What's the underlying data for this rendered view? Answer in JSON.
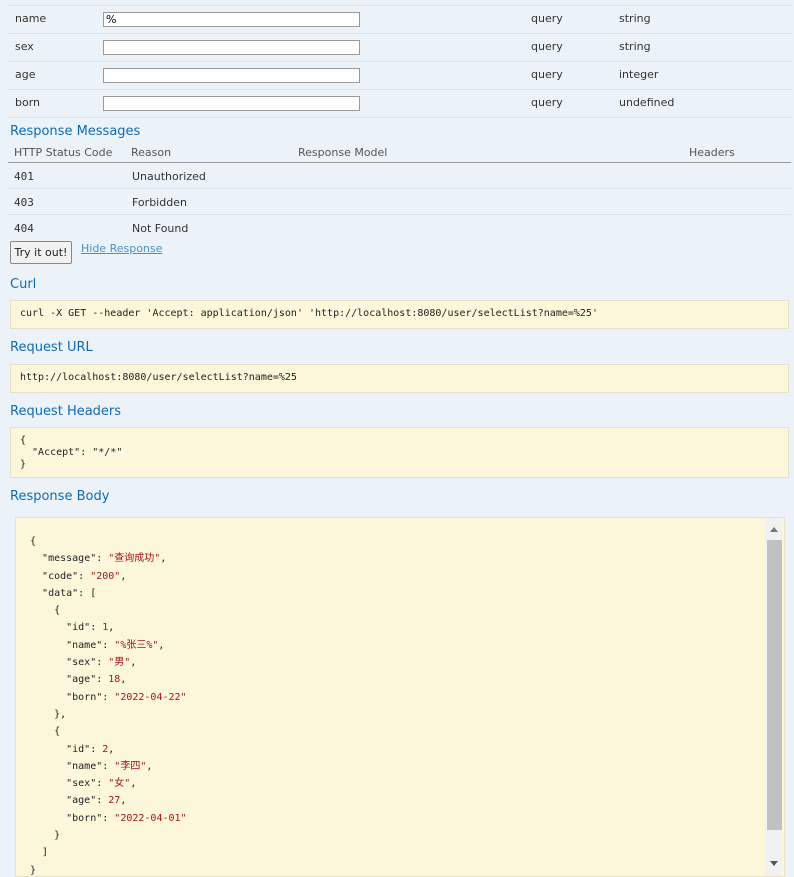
{
  "parameters": [
    {
      "name": "name",
      "value": "%",
      "param_type": "query",
      "data_type": "string"
    },
    {
      "name": "sex",
      "value": "",
      "param_type": "query",
      "data_type": "string"
    },
    {
      "name": "age",
      "value": "",
      "param_type": "query",
      "data_type": "integer"
    },
    {
      "name": "born",
      "value": "",
      "param_type": "query",
      "data_type": "undefined"
    }
  ],
  "response_messages": {
    "title": "Response Messages",
    "headers": [
      "HTTP Status Code",
      "Reason",
      "Response Model",
      "Headers"
    ],
    "rows": [
      {
        "code": "401",
        "reason": "Unauthorized"
      },
      {
        "code": "403",
        "reason": "Forbidden"
      },
      {
        "code": "404",
        "reason": "Not Found"
      }
    ]
  },
  "actions": {
    "try_label": "Try it out!",
    "hide_label": "Hide Response"
  },
  "curl": {
    "title": "Curl",
    "command": "curl -X GET --header 'Accept: application/json' 'http://localhost:8080/user/selectList?name=%25'"
  },
  "request_url": {
    "title": "Request URL",
    "value": "http://localhost:8080/user/selectList?name=%25"
  },
  "request_headers": {
    "title": "Request Headers",
    "value": "{\n  \"Accept\": \"*/*\"\n}"
  },
  "response_body": {
    "title": "Response Body",
    "lines": [
      "{",
      "  \"message\": \"查询成功\",",
      "  \"code\": \"200\",",
      "  \"data\": [",
      "    {",
      "      \"id\": 1,",
      "      \"name\": \"%张三%\",",
      "      \"sex\": \"男\",",
      "      \"age\": 18,",
      "      \"born\": \"2022-04-22\"",
      "    },",
      "    {",
      "      \"id\": 2,",
      "      \"name\": \"李四\",",
      "      \"sex\": \"女\",",
      "      \"age\": 27,",
      "      \"born\": \"2022-04-01\"",
      "    }",
      "  ]",
      "}"
    ]
  }
}
